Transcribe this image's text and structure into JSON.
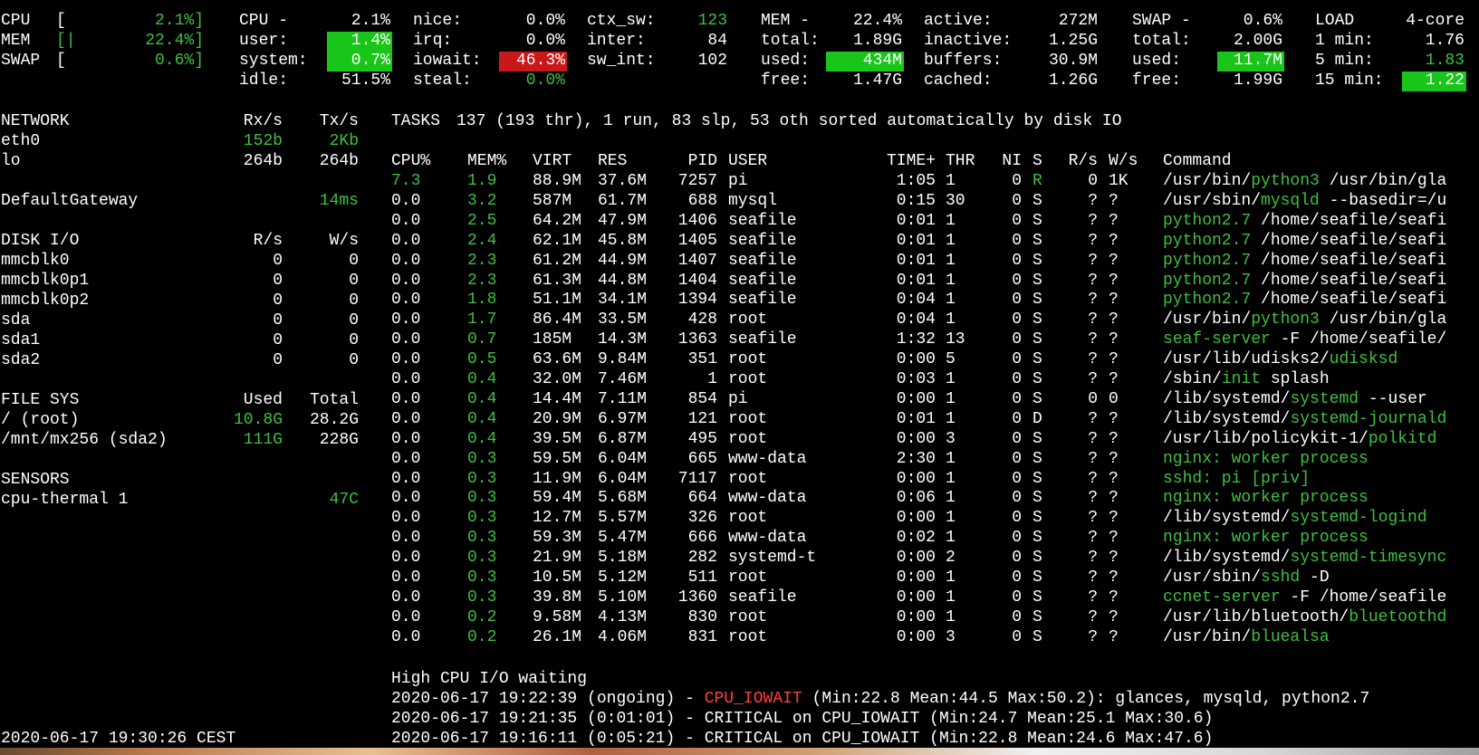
{
  "colors": {
    "background": "#000000",
    "text": "#ffffff",
    "green": "#3fbf3f",
    "highlight_green": "#19c519",
    "highlight_red": "#c81818",
    "critical_red": "#ff4040"
  },
  "quicklook": {
    "cpu_label": "CPU",
    "cpu_open": "[",
    "cpu_pct": "2.1%]",
    "mem_label": "MEM",
    "mem_open": "[|",
    "mem_pct": "22.4%]",
    "swap_label": "SWAP",
    "swap_open": "[",
    "swap_pct": "0.6%]"
  },
  "cpu": {
    "title": "CPU -",
    "total": "2.1%",
    "user_label": "user:",
    "user": "1.4%",
    "system_label": "system:",
    "system": "0.7%",
    "idle_label": "idle:",
    "idle": "51.5%",
    "nice_label": "nice:",
    "nice": "0.0%",
    "irq_label": "irq:",
    "irq": "0.0%",
    "iowait_label": "iowait:",
    "iowait": "46.3%",
    "steal_label": "steal:",
    "steal": "0.0%",
    "ctx_sw_label": "ctx_sw:",
    "ctx_sw": "123",
    "inter_label": "inter:",
    "inter": "84",
    "sw_int_label": "sw_int:",
    "sw_int": "102"
  },
  "mem": {
    "title": "MEM -",
    "total_pct": "22.4%",
    "total_label": "total:",
    "total": "1.89G",
    "used_label": "used:",
    "used": "434M",
    "free_label": "free:",
    "free": "1.47G",
    "active_label": "active:",
    "active": "272M",
    "inactive_label": "inactive:",
    "inactive": "1.25G",
    "buffers_label": "buffers:",
    "buffers": "30.9M",
    "cached_label": "cached:",
    "cached": "1.26G"
  },
  "swap": {
    "title": "SWAP -",
    "pct": "0.6%",
    "total_label": "total:",
    "total": "2.00G",
    "used_label": "used:",
    "used": "11.7M",
    "free_label": "free:",
    "free": "1.99G"
  },
  "load": {
    "title": "LOAD",
    "cores": "4-core",
    "min1_label": "1 min:",
    "min1": "1.76",
    "min5_label": "5 min:",
    "min5": "1.83",
    "min15_label": "15 min:",
    "min15": "1.22"
  },
  "network": {
    "title": "NETWORK",
    "rx_header": "Rx/s",
    "tx_header": "Tx/s",
    "interfaces": [
      {
        "name": "eth0",
        "rx": "152b",
        "tx": "2Kb"
      },
      {
        "name": "lo",
        "rx": "264b",
        "tx": "264b"
      }
    ],
    "gateway_label": "DefaultGateway",
    "gateway_value": "14ms"
  },
  "disk": {
    "title": "DISK I/O",
    "r_header": "R/s",
    "w_header": "W/s",
    "devices": [
      {
        "name": "mmcblk0",
        "r": "0",
        "w": "0"
      },
      {
        "name": "mmcblk0p1",
        "r": "0",
        "w": "0"
      },
      {
        "name": "mmcblk0p2",
        "r": "0",
        "w": "0"
      },
      {
        "name": "sda",
        "r": "0",
        "w": "0"
      },
      {
        "name": "sda1",
        "r": "0",
        "w": "0"
      },
      {
        "name": "sda2",
        "r": "0",
        "w": "0"
      }
    ]
  },
  "fs": {
    "title": "FILE SYS",
    "used_header": "Used",
    "total_header": "Total",
    "mounts": [
      {
        "name": "/ (root)",
        "used": "10.8G",
        "total": "28.2G"
      },
      {
        "name": "/mnt/mx256 (sda2)",
        "used": "111G",
        "total": "228G"
      }
    ]
  },
  "sensors": {
    "title": "SENSORS",
    "items": [
      {
        "name": "cpu-thermal 1",
        "value": "47C"
      }
    ]
  },
  "timestamp": "2020-06-17 19:30:26 CEST",
  "tasks": {
    "label": "TASKS",
    "summary": "137 (193 thr), 1 run, 83 slp, 53 oth sorted automatically by disk IO"
  },
  "proc_headers": {
    "cpu": "CPU%",
    "mem": "MEM%",
    "virt": "VIRT",
    "res": "RES",
    "pid": "PID",
    "user": "USER",
    "time": "TIME+",
    "thr": "THR",
    "ni": "NI",
    "s": "S",
    "rs": "R/s",
    "ws": "W/s",
    "command": "Command"
  },
  "processes": [
    {
      "cpu": "7.3",
      "mem": "1.9",
      "virt": "88.9M",
      "res": "37.6M",
      "pid": "7257",
      "user": "pi",
      "time": "1:05",
      "thr": "1",
      "ni": "0",
      "s": "R",
      "rs": "0",
      "ws": "1K",
      "cmd_pre": "/usr/bin/",
      "cmd_name": "python3",
      "cmd_post": " /usr/bin/gla"
    },
    {
      "cpu": "0.0",
      "mem": "3.2",
      "virt": "587M",
      "res": "61.7M",
      "pid": "688",
      "user": "mysql",
      "time": "0:15",
      "thr": "30",
      "ni": "0",
      "s": "S",
      "rs": "?",
      "ws": "?",
      "cmd_pre": "/usr/sbin/",
      "cmd_name": "mysqld",
      "cmd_post": " --basedir=/u"
    },
    {
      "cpu": "0.0",
      "mem": "2.5",
      "virt": "64.2M",
      "res": "47.9M",
      "pid": "1406",
      "user": "seafile",
      "time": "0:01",
      "thr": "1",
      "ni": "0",
      "s": "S",
      "rs": "?",
      "ws": "?",
      "cmd_pre": "",
      "cmd_name": "python2.7",
      "cmd_post": " /home/seafile/seafi"
    },
    {
      "cpu": "0.0",
      "mem": "2.4",
      "virt": "62.1M",
      "res": "45.8M",
      "pid": "1405",
      "user": "seafile",
      "time": "0:01",
      "thr": "1",
      "ni": "0",
      "s": "S",
      "rs": "?",
      "ws": "?",
      "cmd_pre": "",
      "cmd_name": "python2.7",
      "cmd_post": " /home/seafile/seafi"
    },
    {
      "cpu": "0.0",
      "mem": "2.3",
      "virt": "61.2M",
      "res": "44.9M",
      "pid": "1407",
      "user": "seafile",
      "time": "0:01",
      "thr": "1",
      "ni": "0",
      "s": "S",
      "rs": "?",
      "ws": "?",
      "cmd_pre": "",
      "cmd_name": "python2.7",
      "cmd_post": " /home/seafile/seafi"
    },
    {
      "cpu": "0.0",
      "mem": "2.3",
      "virt": "61.3M",
      "res": "44.8M",
      "pid": "1404",
      "user": "seafile",
      "time": "0:01",
      "thr": "1",
      "ni": "0",
      "s": "S",
      "rs": "?",
      "ws": "?",
      "cmd_pre": "",
      "cmd_name": "python2.7",
      "cmd_post": " /home/seafile/seafi"
    },
    {
      "cpu": "0.0",
      "mem": "1.8",
      "virt": "51.1M",
      "res": "34.1M",
      "pid": "1394",
      "user": "seafile",
      "time": "0:04",
      "thr": "1",
      "ni": "0",
      "s": "S",
      "rs": "?",
      "ws": "?",
      "cmd_pre": "",
      "cmd_name": "python2.7",
      "cmd_post": " /home/seafile/seafi"
    },
    {
      "cpu": "0.0",
      "mem": "1.7",
      "virt": "86.4M",
      "res": "33.5M",
      "pid": "428",
      "user": "root",
      "time": "0:04",
      "thr": "1",
      "ni": "0",
      "s": "S",
      "rs": "?",
      "ws": "?",
      "cmd_pre": "/usr/bin/",
      "cmd_name": "python3",
      "cmd_post": " /usr/bin/gla"
    },
    {
      "cpu": "0.0",
      "mem": "0.7",
      "virt": "185M",
      "res": "14.3M",
      "pid": "1363",
      "user": "seafile",
      "time": "1:32",
      "thr": "13",
      "ni": "0",
      "s": "S",
      "rs": "?",
      "ws": "?",
      "cmd_pre": "",
      "cmd_name": "seaf-server",
      "cmd_post": " -F /home/seafile/"
    },
    {
      "cpu": "0.0",
      "mem": "0.5",
      "virt": "63.6M",
      "res": "9.84M",
      "pid": "351",
      "user": "root",
      "time": "0:00",
      "thr": "5",
      "ni": "0",
      "s": "S",
      "rs": "?",
      "ws": "?",
      "cmd_pre": "/usr/lib/udisks2/",
      "cmd_name": "udisksd",
      "cmd_post": ""
    },
    {
      "cpu": "0.0",
      "mem": "0.4",
      "virt": "32.0M",
      "res": "7.46M",
      "pid": "1",
      "user": "root",
      "time": "0:03",
      "thr": "1",
      "ni": "0",
      "s": "S",
      "rs": "?",
      "ws": "?",
      "cmd_pre": "/sbin/",
      "cmd_name": "init",
      "cmd_post": " splash"
    },
    {
      "cpu": "0.0",
      "mem": "0.4",
      "virt": "14.4M",
      "res": "7.11M",
      "pid": "854",
      "user": "pi",
      "time": "0:00",
      "thr": "1",
      "ni": "0",
      "s": "S",
      "rs": "0",
      "ws": "0",
      "cmd_pre": "/lib/systemd/",
      "cmd_name": "systemd",
      "cmd_post": " --user"
    },
    {
      "cpu": "0.0",
      "mem": "0.4",
      "virt": "20.9M",
      "res": "6.97M",
      "pid": "121",
      "user": "root",
      "time": "0:01",
      "thr": "1",
      "ni": "0",
      "s": "D",
      "rs": "?",
      "ws": "?",
      "cmd_pre": "/lib/systemd/",
      "cmd_name": "systemd-journald",
      "cmd_post": ""
    },
    {
      "cpu": "0.0",
      "mem": "0.4",
      "virt": "39.5M",
      "res": "6.87M",
      "pid": "495",
      "user": "root",
      "time": "0:00",
      "thr": "3",
      "ni": "0",
      "s": "S",
      "rs": "?",
      "ws": "?",
      "cmd_pre": "/usr/lib/policykit-1/",
      "cmd_name": "polkitd",
      "cmd_post": ""
    },
    {
      "cpu": "0.0",
      "mem": "0.3",
      "virt": "59.5M",
      "res": "6.04M",
      "pid": "665",
      "user": "www-data",
      "time": "2:30",
      "thr": "1",
      "ni": "0",
      "s": "S",
      "rs": "?",
      "ws": "?",
      "cmd_pre": "",
      "cmd_name": "nginx: worker process",
      "cmd_post": ""
    },
    {
      "cpu": "0.0",
      "mem": "0.3",
      "virt": "11.9M",
      "res": "6.04M",
      "pid": "7117",
      "user": "root",
      "time": "0:00",
      "thr": "1",
      "ni": "0",
      "s": "S",
      "rs": "?",
      "ws": "?",
      "cmd_pre": "",
      "cmd_name": "sshd: pi [priv]",
      "cmd_post": ""
    },
    {
      "cpu": "0.0",
      "mem": "0.3",
      "virt": "59.4M",
      "res": "5.68M",
      "pid": "664",
      "user": "www-data",
      "time": "0:06",
      "thr": "1",
      "ni": "0",
      "s": "S",
      "rs": "?",
      "ws": "?",
      "cmd_pre": "",
      "cmd_name": "nginx: worker process",
      "cmd_post": ""
    },
    {
      "cpu": "0.0",
      "mem": "0.3",
      "virt": "12.7M",
      "res": "5.57M",
      "pid": "326",
      "user": "root",
      "time": "0:00",
      "thr": "1",
      "ni": "0",
      "s": "S",
      "rs": "?",
      "ws": "?",
      "cmd_pre": "/lib/systemd/",
      "cmd_name": "systemd-logind",
      "cmd_post": ""
    },
    {
      "cpu": "0.0",
      "mem": "0.3",
      "virt": "59.3M",
      "res": "5.47M",
      "pid": "666",
      "user": "www-data",
      "time": "0:02",
      "thr": "1",
      "ni": "0",
      "s": "S",
      "rs": "?",
      "ws": "?",
      "cmd_pre": "",
      "cmd_name": "nginx: worker process",
      "cmd_post": ""
    },
    {
      "cpu": "0.0",
      "mem": "0.3",
      "virt": "21.9M",
      "res": "5.18M",
      "pid": "282",
      "user": "systemd-t",
      "time": "0:00",
      "thr": "2",
      "ni": "0",
      "s": "S",
      "rs": "?",
      "ws": "?",
      "cmd_pre": "/lib/systemd/",
      "cmd_name": "systemd-timesync",
      "cmd_post": ""
    },
    {
      "cpu": "0.0",
      "mem": "0.3",
      "virt": "10.5M",
      "res": "5.12M",
      "pid": "511",
      "user": "root",
      "time": "0:00",
      "thr": "1",
      "ni": "0",
      "s": "S",
      "rs": "?",
      "ws": "?",
      "cmd_pre": "/usr/sbin/",
      "cmd_name": "sshd",
      "cmd_post": " -D"
    },
    {
      "cpu": "0.0",
      "mem": "0.3",
      "virt": "39.8M",
      "res": "5.10M",
      "pid": "1360",
      "user": "seafile",
      "time": "0:00",
      "thr": "1",
      "ni": "0",
      "s": "S",
      "rs": "?",
      "ws": "?",
      "cmd_pre": "",
      "cmd_name": "ccnet-server",
      "cmd_post": " -F /home/seafile"
    },
    {
      "cpu": "0.0",
      "mem": "0.2",
      "virt": "9.58M",
      "res": "4.13M",
      "pid": "830",
      "user": "root",
      "time": "0:00",
      "thr": "1",
      "ni": "0",
      "s": "S",
      "rs": "?",
      "ws": "?",
      "cmd_pre": "/usr/lib/bluetooth/",
      "cmd_name": "bluetoothd",
      "cmd_post": ""
    },
    {
      "cpu": "0.0",
      "mem": "0.2",
      "virt": "26.1M",
      "res": "4.06M",
      "pid": "831",
      "user": "root",
      "time": "0:00",
      "thr": "3",
      "ni": "0",
      "s": "S",
      "rs": "?",
      "ws": "?",
      "cmd_pre": "/usr/bin/",
      "cmd_name": "bluealsa",
      "cmd_post": ""
    }
  ],
  "alerts": {
    "title": "High CPU I/O waiting",
    "items": [
      {
        "time": "2020-06-17 19:22:39",
        "dur": "(ongoing)",
        "sep": "-",
        "kind": "CPU_IOWAIT",
        "detail": "(Min:22.8 Mean:44.5 Max:50.2): glances, mysqld, python2.7"
      },
      {
        "time": "2020-06-17 19:21:35",
        "dur": "(0:01:01)",
        "sep": "-",
        "kind": "CRITICAL on CPU_IOWAIT",
        "detail": "(Min:24.7 Mean:25.1 Max:30.6)"
      },
      {
        "time": "2020-06-17 19:16:11",
        "dur": "(0:05:21)",
        "sep": "-",
        "kind": "CRITICAL on CPU_IOWAIT",
        "detail": "(Min:22.8 Mean:24.6 Max:47.6)"
      }
    ]
  }
}
